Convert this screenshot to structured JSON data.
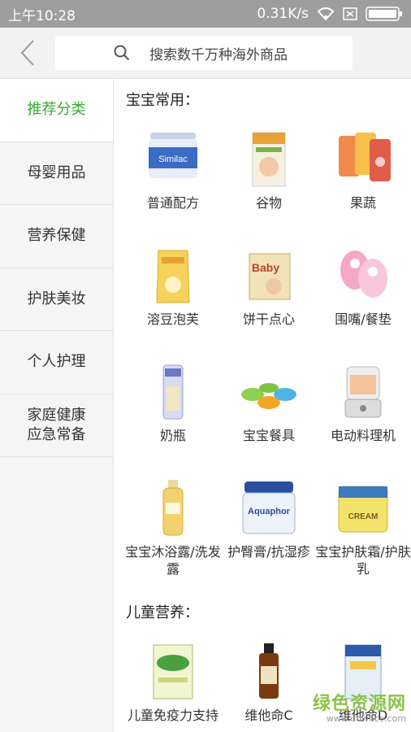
{
  "status": {
    "time": "上午10:28",
    "speed": "0.31K/s"
  },
  "header": {
    "search_placeholder": "搜索数千万种海外商品"
  },
  "sidebar": {
    "items": [
      {
        "label": "推荐分类"
      },
      {
        "label": "母婴用品"
      },
      {
        "label": "营养保健"
      },
      {
        "label": "护肤美妆"
      },
      {
        "label": "个人护理"
      },
      {
        "label": "家庭健康\n应急常备"
      }
    ]
  },
  "sections": [
    {
      "title": "宝宝常用：",
      "items": [
        {
          "label": "普通配方",
          "icon": "formula-can-icon"
        },
        {
          "label": "谷物",
          "icon": "cereal-box-icon"
        },
        {
          "label": "果蔬",
          "icon": "fruit-pouch-icon"
        },
        {
          "label": "溶豆泡芙",
          "icon": "snack-bag-icon"
        },
        {
          "label": "饼干点心",
          "icon": "biscuit-box-icon"
        },
        {
          "label": "围嘴/餐垫",
          "icon": "bib-icon"
        },
        {
          "label": "奶瓶",
          "icon": "baby-bottle-icon"
        },
        {
          "label": "宝宝餐具",
          "icon": "bowls-icon"
        },
        {
          "label": "电动料理机",
          "icon": "blender-icon"
        },
        {
          "label": "宝宝沐浴露/洗发露",
          "icon": "shampoo-bottle-icon"
        },
        {
          "label": "护臀膏/抗湿疹",
          "icon": "cream-jar-icon"
        },
        {
          "label": "宝宝护肤霜/护肤乳",
          "icon": "lotion-jar-icon"
        }
      ]
    },
    {
      "title": "儿童营养：",
      "items": [
        {
          "label": "儿童免疫力支持",
          "icon": "supplement-box-icon"
        },
        {
          "label": "维他命C",
          "icon": "vitamin-bottle-icon"
        },
        {
          "label": "维他命D",
          "icon": "vitamin-d-box-icon"
        }
      ]
    }
  ],
  "watermark": {
    "line1": "绿色资源网",
    "line2": "www.downcc.com"
  },
  "colors": {
    "accent": "#3aaa35",
    "status_bar": "#9e9e9e"
  }
}
